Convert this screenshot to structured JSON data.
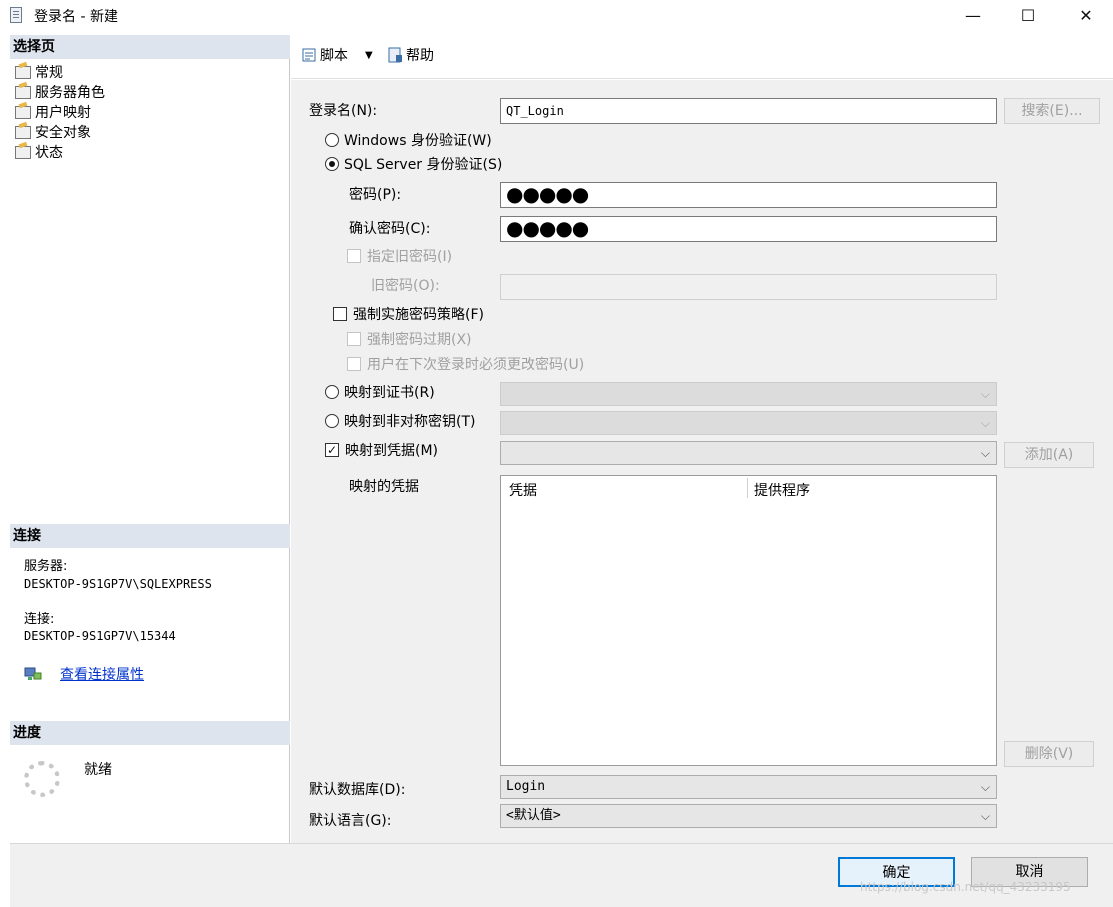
{
  "window": {
    "title": "登录名 - 新建",
    "minimize": "—",
    "maximize": "☐",
    "close": "✕"
  },
  "left": {
    "select_page_header": "选择页",
    "pages": [
      "常规",
      "服务器角色",
      "用户映射",
      "安全对象",
      "状态"
    ],
    "connection_header": "连接",
    "server_label": "服务器:",
    "server_value": "DESKTOP-9S1GP7V\\SQLEXPRESS",
    "connection_label": "连接:",
    "connection_value": "DESKTOP-9S1GP7V\\15344",
    "view_props_link": "查看连接属性",
    "progress_header": "进度",
    "progress_status": "就绪"
  },
  "toolbar": {
    "script_label": "脚本",
    "script_dropdown": "▼",
    "help_label": "帮助"
  },
  "form": {
    "login_name_label": "登录名(N):",
    "login_name_value": "QT_Login",
    "search_button": "搜索(E)...",
    "windows_auth": "Windows 身份验证(W)",
    "sql_auth": "SQL Server 身份验证(S)",
    "password_label": "密码(P):",
    "password_value": "●●●●●",
    "confirm_password_label": "确认密码(C):",
    "confirm_password_value": "●●●●●",
    "specify_old_password": "指定旧密码(I)",
    "old_password_label": "旧密码(O):",
    "enforce_policy": "强制实施密码策略(F)",
    "enforce_expiration": "强制密码过期(X)",
    "must_change": "用户在下次登录时必须更改密码(U)",
    "map_certificate": "映射到证书(R)",
    "map_asymmetric_key": "映射到非对称密钥(T)",
    "map_credential": "映射到凭据(M)",
    "add_button": "添加(A)",
    "mapped_credentials_label": "映射的凭据",
    "grid_col_credential": "凭据",
    "grid_col_provider": "提供程序",
    "remove_button": "删除(V)",
    "default_database_label": "默认数据库(D):",
    "default_database_value": "Login",
    "default_language_label": "默认语言(G):",
    "default_language_value": "<默认值>",
    "combo_arrow": "⌵",
    "check_mark": "✓"
  },
  "buttons": {
    "ok": "确定",
    "cancel": "取消"
  },
  "watermark": "https://blog.csdn.net/qq_43233195"
}
